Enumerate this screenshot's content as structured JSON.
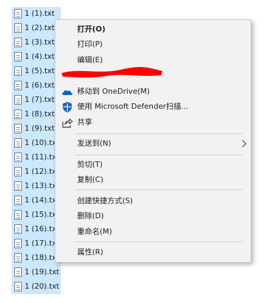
{
  "files": [
    "1 (1).txt",
    "1 (2).txt",
    "1 (3).txt",
    "1 (4).txt",
    "1 (5).txt",
    "1 (6).txt",
    "1 (7).txt",
    "1 (8).txt",
    "1 (9).txt",
    "1 (10).txt",
    "1 (11).txt",
    "1 (12).txt",
    "1 (13).txt",
    "1 (14).txt",
    "1 (15).txt",
    "1 (16).txt",
    "1 (17).txt",
    "1 (18).txt",
    "1 (19).txt",
    "1 (20).txt"
  ],
  "context_menu": {
    "open": "打开(O)",
    "print": "打印(P)",
    "edit": "编辑(E)",
    "onedrive": "移动到 OneDrive(M)",
    "defender": "使用 Microsoft Defender扫描...",
    "share": "共享",
    "send_to": "发送到(N)",
    "cut": "剪切(T)",
    "copy": "复制(C)",
    "create_shortcut": "创建快捷方式(S)",
    "delete": "删除(D)",
    "rename": "重命名(M)",
    "properties": "属性(R)"
  },
  "icons": {
    "file": "text-file-icon",
    "onedrive": "onedrive-cloud-icon",
    "defender": "defender-shield-icon",
    "share": "share-icon",
    "submenu": "chevron-right-icon"
  },
  "colors": {
    "selection": "#cce8ff",
    "menu_bg": "#f2f2f2",
    "onedrive_blue": "#0a64c8",
    "defender_blue": "#1565c0",
    "redaction_red": "#ff0000"
  }
}
